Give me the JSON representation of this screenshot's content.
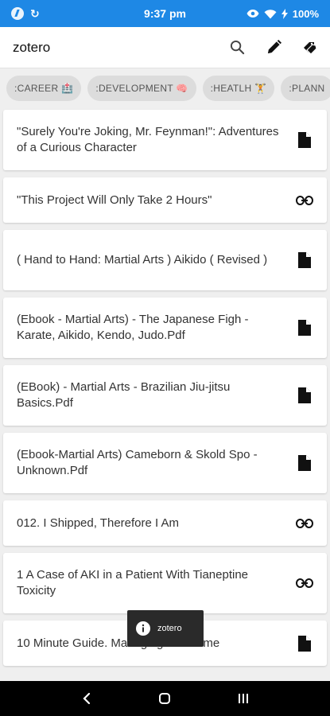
{
  "status": {
    "time": "9:37 pm",
    "battery": "100%",
    "sync_glyph": "↻"
  },
  "app": {
    "title": "zotero"
  },
  "chips": [
    {
      "label": ":CAREER 🏥"
    },
    {
      "label": ":DEVELOPMENT 🧠"
    },
    {
      "label": ":HEATLH 🏋"
    },
    {
      "label": ":PLANN"
    }
  ],
  "items": [
    {
      "title": "\"Surely You're Joking, Mr. Feynman!\": Adventures of a Curious Character",
      "icon": "document-icon"
    },
    {
      "title": "\"This Project Will Only Take 2 Hours\"",
      "icon": "link-icon"
    },
    {
      "title": "( Hand to Hand: Martial Arts ) Aikido ( Revised )",
      "icon": "document-icon"
    },
    {
      "title": "(Ebook - Martial Arts) - The Japanese Figh - Karate, Aikido, Kendo, Judo.Pdf",
      "icon": "document-icon"
    },
    {
      "title": "(EBook) - Martial Arts - Brazilian Jiu-jitsu Basics.Pdf",
      "icon": "document-icon"
    },
    {
      "title": "(Ebook-Martial Arts) Cameborn & Skold Spo - Unknown.Pdf",
      "icon": "document-icon"
    },
    {
      "title": "012. I Shipped, Therefore I Am",
      "icon": "link-icon"
    },
    {
      "title": "1 A Case of AKI in a Patient With Tianeptine Toxicity",
      "icon": "link-icon"
    },
    {
      "title": "10 Minute Guide. Managing Your Time",
      "icon": "document-icon"
    }
  ],
  "toast": {
    "text": "zotero"
  },
  "colors": {
    "status_bar": "#1e88e5",
    "background": "#efefef"
  }
}
